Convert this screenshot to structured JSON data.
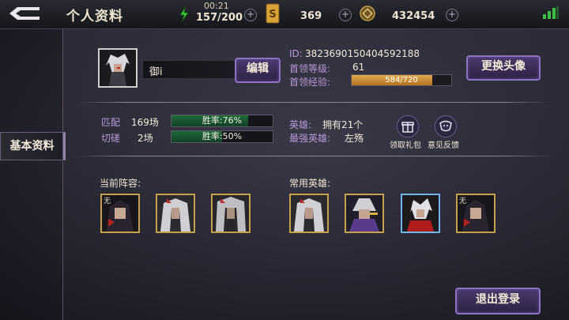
{
  "header": {
    "title": "个人资料",
    "clock": "00:21",
    "stamina": "157/200",
    "tickets": "369",
    "coins": "432454"
  },
  "nav": {
    "tab_basic": "基本资料"
  },
  "profile": {
    "name": "御i",
    "edit_label": "编辑",
    "change_avatar_label": "更换头像",
    "id_label": "ID:",
    "id_value": "3823690150404592188",
    "level_label": "首领等级:",
    "level_value": "61",
    "exp_label": "首领经验:",
    "exp_value": "584/720",
    "exp_fraction": 0.811
  },
  "stats": {
    "match_label": "匹配",
    "match_count": "169场",
    "match_rate_text": "胜率:76%",
    "match_rate": 0.76,
    "spar_label": "切磋",
    "spar_count": "2场",
    "spar_rate_text": "胜率:50%",
    "spar_rate": 0.5,
    "hero_label": "英雄:",
    "hero_value": "拥有21个",
    "strongest_label": "最强英雄:",
    "strongest_value": "左殇",
    "gift_label": "领取礼包",
    "feedback_label": "意见反馈"
  },
  "lineup": {
    "current_title": "当前阵容:",
    "favorite_title": "常用英雄:",
    "current_corner_1": "无"
  },
  "logout_label": "退出登录",
  "colors": {
    "accent_purple": "#8c74c2",
    "exp_gold": "#e1a94d",
    "rate_green": "#1f6a3a",
    "stamina_green": "#3fcf3a"
  }
}
